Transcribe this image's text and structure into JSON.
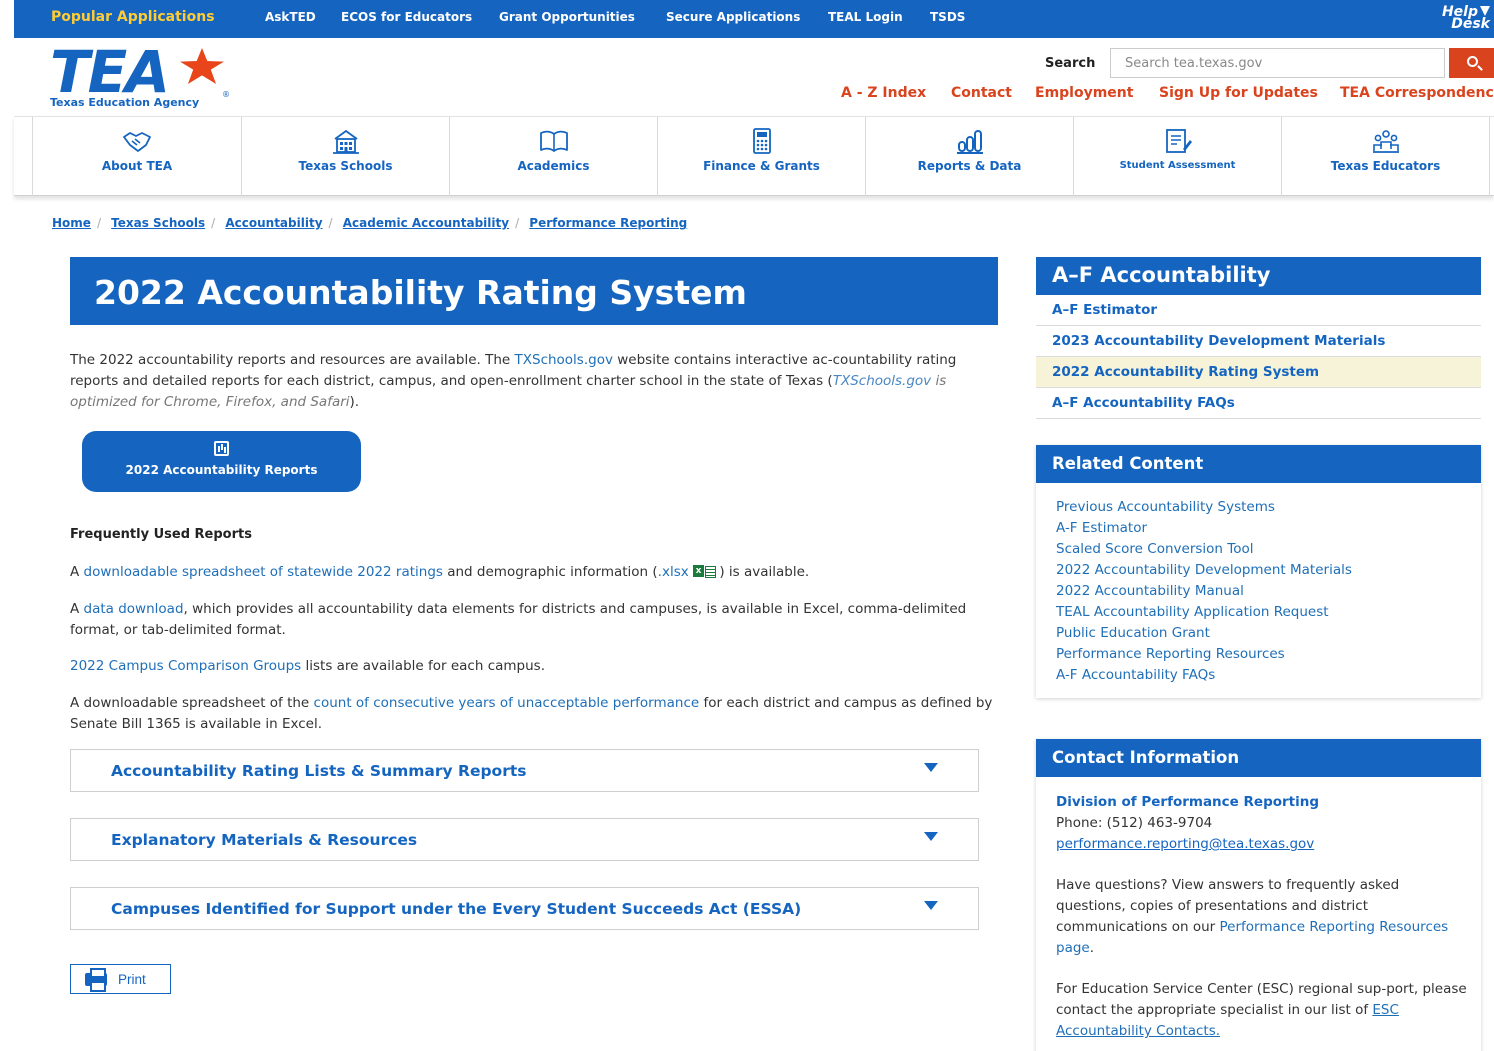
{
  "topbar": {
    "popular": "Popular Applications",
    "items": [
      "AskTED",
      "ECOS for Educators",
      "Grant Opportunities",
      "Secure Applications",
      "TEAL Login",
      "TSDS"
    ],
    "helpdesk_line1": "Help",
    "helpdesk_line2": "Desk"
  },
  "header": {
    "logo_text": "TEA",
    "logo_subtitle": "Texas Education Agency",
    "logo_reg": "®",
    "search_label": "Search",
    "search_placeholder": "Search tea.texas.gov",
    "utility_links": [
      "A - Z Index",
      "Contact",
      "Employment",
      "Sign Up for Updates",
      "TEA Correspondence"
    ]
  },
  "nav": [
    {
      "label": "About TEA",
      "icon": "handshake-icon"
    },
    {
      "label": "Texas Schools",
      "icon": "school-building-icon"
    },
    {
      "label": "Academics",
      "icon": "open-book-icon"
    },
    {
      "label": "Finance & Grants",
      "icon": "calculator-icon"
    },
    {
      "label": "Reports & Data",
      "icon": "bar-chart-icon"
    },
    {
      "label": "Student Assessment",
      "icon": "test-sheet-icon"
    },
    {
      "label": "Texas Educators",
      "icon": "group-of-people-icon"
    }
  ],
  "breadcrumb": [
    "Home",
    "Texas Schools",
    "Accountability",
    "Academic Accountability",
    "Performance Reporting"
  ],
  "main": {
    "title": "2022 Accountability Rating System",
    "intro_1": "The 2022 accountability reports and resources are available. The ",
    "intro_link": "TXSchools.gov",
    "intro_2": " website contains interactive ac-countability rating reports and detailed reports for each district, campus, and open-enrollment charter school in the state of Texas (",
    "intro_note_link": "TXSchools.gov",
    "intro_note": " is optimized for Chrome, Firefox, and Safari",
    "intro_end": ").",
    "reports_button": "2022 Accountability Reports",
    "section_heading": "Frequently Used Reports",
    "p1_a": "A ",
    "p1_link": "downloadable spreadsheet of statewide 2022 ratings",
    "p1_b": " and demographic information (",
    "p1_xlsx": ".xlsx",
    "p1_c": " ) is available.",
    "p2_a": "A ",
    "p2_link": "data download",
    "p2_b": ", which provides all accountability data elements for districts and campuses, is available in Excel, comma-delimited format, or tab-delimited format.",
    "p3_link": "2022 Campus Comparison Groups",
    "p3_b": " lists are available for each campus.",
    "p4_a": "A downloadable spreadsheet of the ",
    "p4_link": "count of consecutive years of unacceptable performance",
    "p4_b": " for each district and campus as defined by Senate Bill 1365 is available in Excel.",
    "accordions": [
      "Accountability Rating Lists & Summary Reports",
      "Explanatory Materials & Resources",
      "Campuses Identified for Support under the Every Student Succeeds Act (ESSA)"
    ],
    "print_label": "Print"
  },
  "sidebar": {
    "af_title": "A–F Accountability",
    "af_links": [
      "A–F Estimator",
      "2023 Accountability Development Materials",
      "2022 Accountability Rating System",
      "A–F Accountability FAQs"
    ],
    "related_title": "Related Content",
    "related_links": [
      "Previous Accountability Systems",
      "A-F Estimator",
      "Scaled Score Conversion Tool",
      "2022 Accountability Development Materials",
      "2022 Accountability Manual",
      "TEAL Accountability Application Request",
      "Public Education Grant",
      "Performance Reporting Resources",
      "A-F Accountability FAQs"
    ],
    "contact_title": "Contact Information",
    "division": "Division of Performance Reporting",
    "phone": "Phone: (512) 463-9704",
    "email": "performance.reporting@tea.texas.gov",
    "q_text": "Have questions? View answers to frequently asked questions, copies of presentations and district communications on our ",
    "q_link": "Performance Reporting Resources page",
    "q_end": ".",
    "esc_text": "For Education Service Center (ESC) regional sup-port, please contact the appropriate specialist in our list of ",
    "esc_link": "ESC Accountability Contacts."
  },
  "colors": {
    "brand_blue": "#1565c0",
    "accent_orange": "#d9441e",
    "active_highlight": "#f6f3d9"
  }
}
